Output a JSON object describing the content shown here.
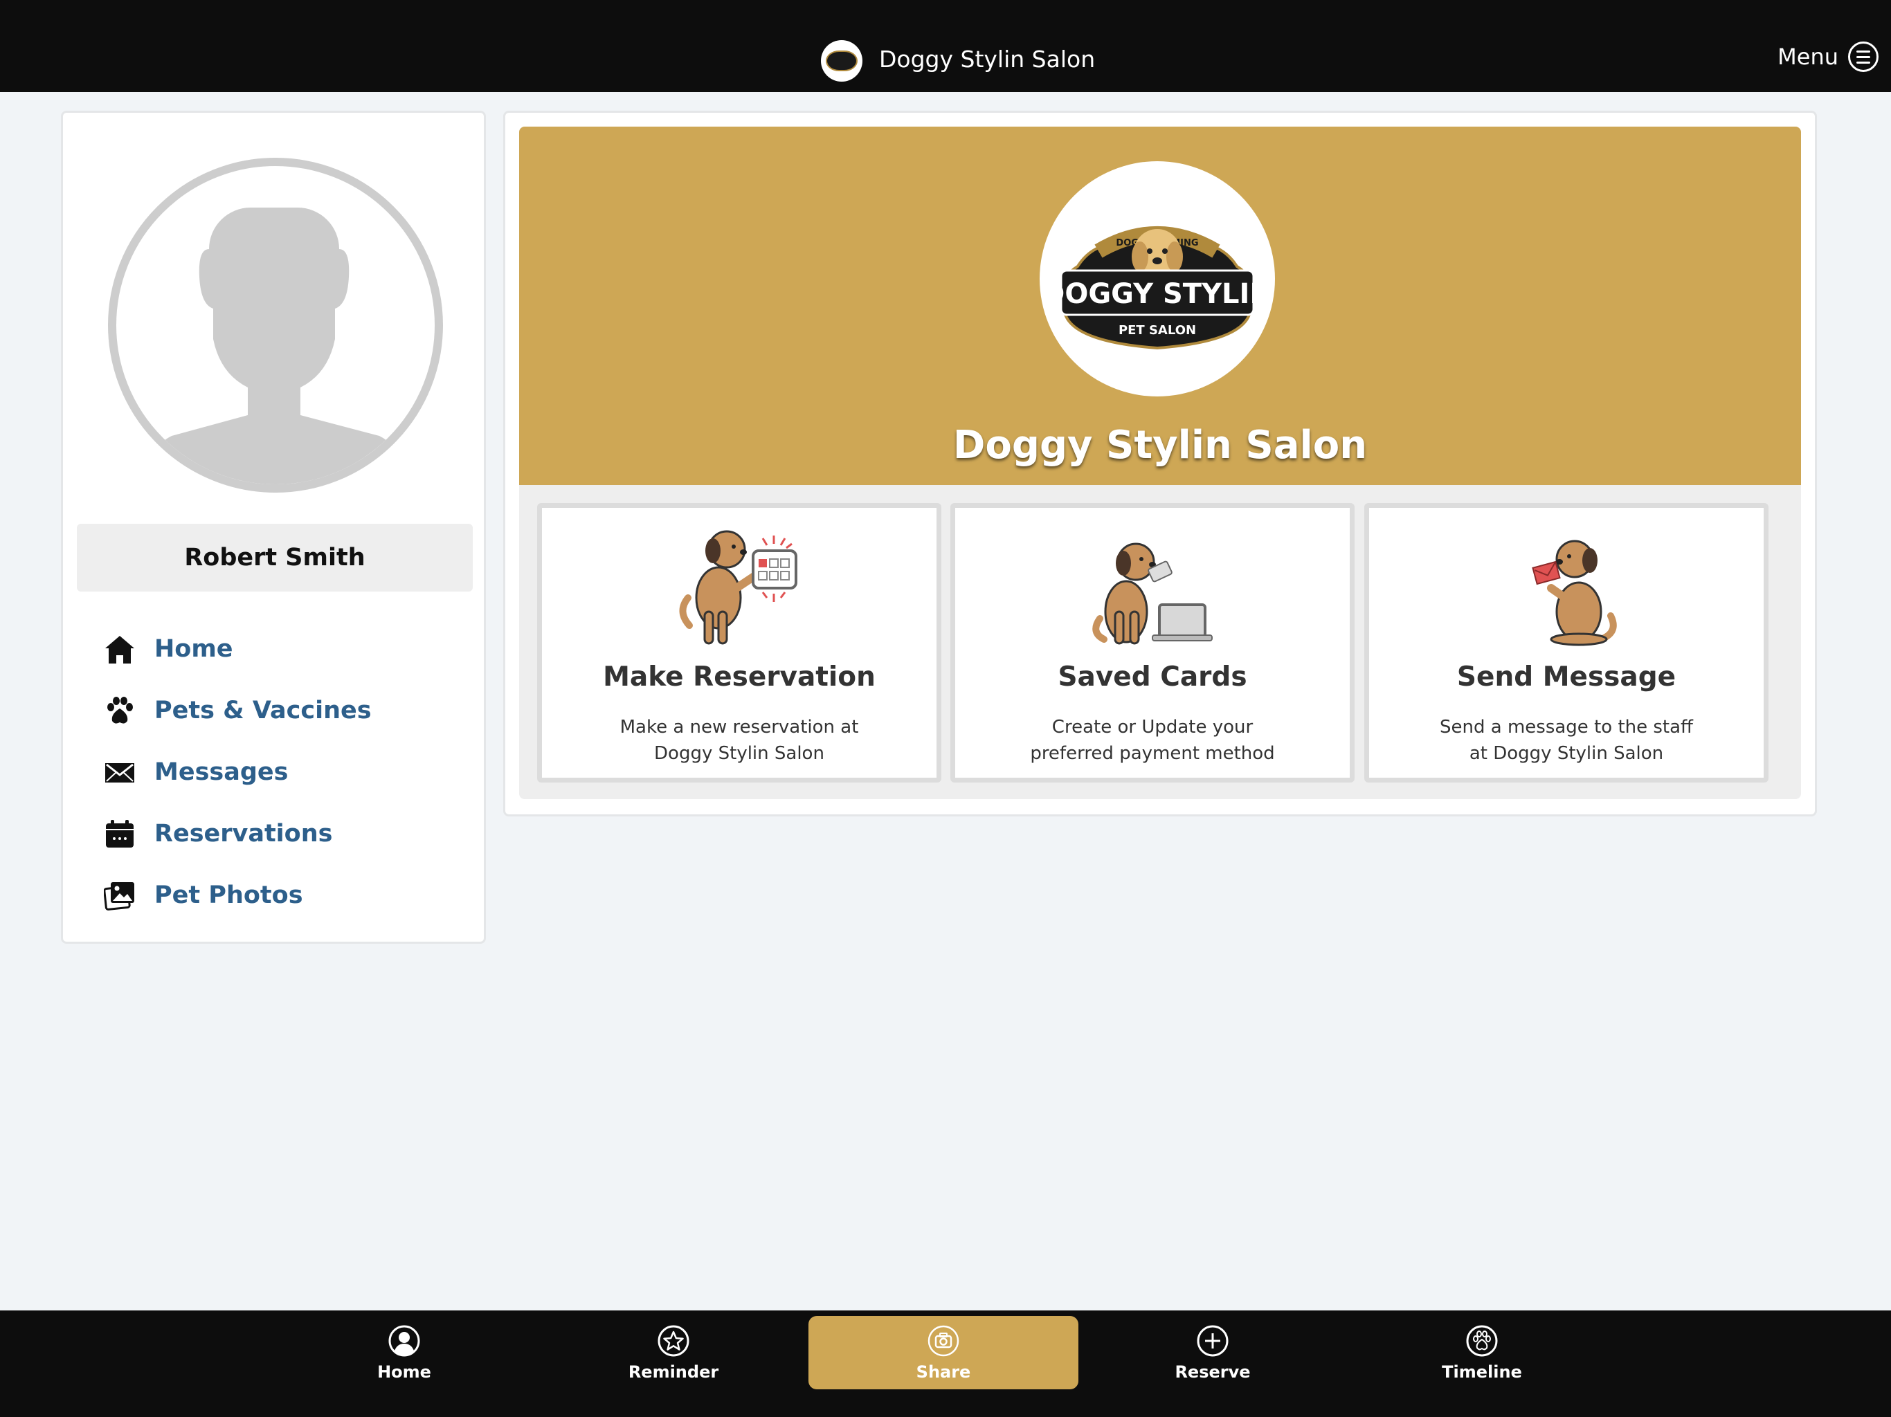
{
  "header": {
    "title": "Doggy Stylin Salon",
    "menu_label": "Menu"
  },
  "sidebar": {
    "user_name": "Robert Smith",
    "items": [
      {
        "label": "Home",
        "icon": "home-icon"
      },
      {
        "label": "Pets & Vaccines",
        "icon": "paw-icon"
      },
      {
        "label": "Messages",
        "icon": "envelope-icon"
      },
      {
        "label": "Reservations",
        "icon": "calendar-icon"
      },
      {
        "label": "Pet Photos",
        "icon": "photos-icon"
      }
    ]
  },
  "banner": {
    "salon_name": "Doggy Stylin Salon",
    "logo": {
      "arc_text": "DOG GROOMING",
      "main_text": "DOGGY STYLIN",
      "sub_text": "PET SALON"
    }
  },
  "cards": [
    {
      "title": "Make Reservation",
      "desc_line1": "Make a new reservation at",
      "desc_line2": "Doggy Stylin Salon",
      "icon": "dog-calendar-illustration"
    },
    {
      "title": "Saved Cards",
      "desc_line1": "Create or Update your",
      "desc_line2": "preferred payment method",
      "icon": "dog-card-illustration"
    },
    {
      "title": "Send Message",
      "desc_line1": "Send a message to the staff",
      "desc_line2": "at Doggy Stylin Salon",
      "icon": "dog-letter-illustration"
    }
  ],
  "bottom_nav": {
    "tabs": [
      {
        "label": "Home",
        "icon": "person-circle-icon"
      },
      {
        "label": "Reminder",
        "icon": "star-circle-icon"
      },
      {
        "label": "Share",
        "icon": "camera-circle-icon",
        "active": true
      },
      {
        "label": "Reserve",
        "icon": "plus-circle-icon"
      },
      {
        "label": "Timeline",
        "icon": "paw-circle-icon"
      }
    ]
  },
  "colors": {
    "accent": "#cea755",
    "bar": "#0d0d0d",
    "link": "#2d5f8b",
    "background": "#f1f4f7"
  }
}
